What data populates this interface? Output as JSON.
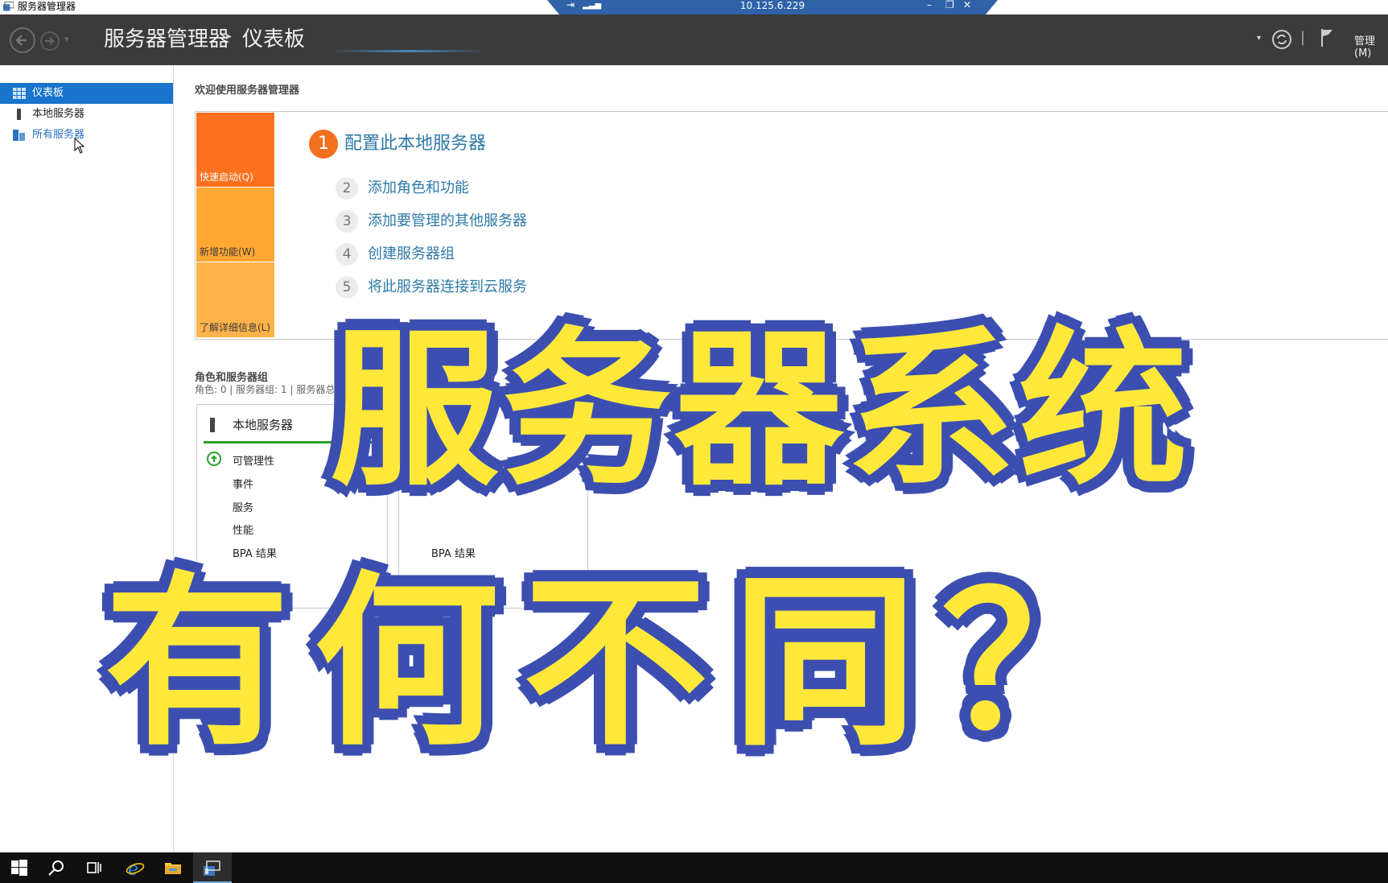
{
  "window": {
    "title": "服务器管理器"
  },
  "rdp": {
    "address": "10.125.6.229"
  },
  "header": {
    "app": "服务器管理器",
    "separator": "▸",
    "page": "仪表板",
    "manage_label": "管理(M)"
  },
  "sidebar": {
    "items": [
      {
        "label": "仪表板",
        "active": true
      },
      {
        "label": "本地服务器",
        "active": false
      },
      {
        "label": "所有服务器",
        "active": false
      }
    ]
  },
  "main": {
    "welcome": "欢迎使用服务器管理器",
    "tiles": [
      "快速启动(Q)",
      "新增功能(W)",
      "了解详细信息(L)"
    ],
    "primary_step": {
      "num": "1",
      "label": "配置此本地服务器"
    },
    "steps": [
      {
        "num": "2",
        "label": "添加角色和功能"
      },
      {
        "num": "3",
        "label": "添加要管理的其他服务器"
      },
      {
        "num": "4",
        "label": "创建服务器组"
      },
      {
        "num": "5",
        "label": "将此服务器连接到云服务"
      }
    ],
    "roles": {
      "title": "角色和服务器组",
      "summary": "角色: 0 | 服务器组: 1 | 服务器总数: 1"
    },
    "card1": {
      "title": "本地服务器",
      "rows": [
        "可管理性",
        "事件",
        "服务",
        "性能",
        "BPA 结果"
      ]
    },
    "card2": {
      "last_row": "BPA 结果"
    }
  },
  "overlay": {
    "line1": "服务器系统",
    "line2": "有何不同？"
  },
  "colors": {
    "header_bg": "#3b3b3b",
    "accent_blue": "#1874cd",
    "tile_orange": "#fd701d",
    "overlay_fill": "#ffe83a",
    "overlay_stroke": "#3c4fb0"
  }
}
